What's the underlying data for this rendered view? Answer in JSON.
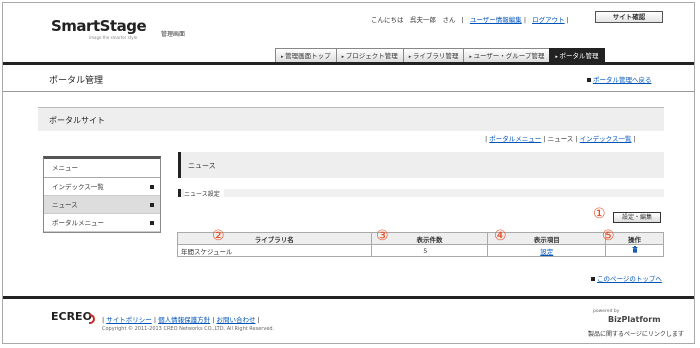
{
  "header": {
    "logo": "SmartStage",
    "logo_sub": "image the smarter style",
    "admin_title": "管理画面",
    "greeting": "こんにちは　呉夫一郎　さん",
    "user_info_edit": "ユーザー情報編集",
    "logout": "ログアウト",
    "site_confirm": "サイト確認"
  },
  "nav": {
    "items": [
      {
        "label": "管理画面トップ",
        "active": false
      },
      {
        "label": "プロジェクト管理",
        "active": false
      },
      {
        "label": "ライブラリ管理",
        "active": false
      },
      {
        "label": "ユーザー・グループ管理",
        "active": false
      },
      {
        "label": "ポータル管理",
        "active": true
      }
    ]
  },
  "page": {
    "title": "ポータル管理",
    "back_link": "ポータル管理へ戻る",
    "section_title": "ポータルサイト",
    "sub_links": [
      "ポータルメニュー",
      "ニュース",
      "インデックス一覧"
    ]
  },
  "menu": {
    "heading": "メニュー",
    "items": [
      {
        "label": "インデックス一覧",
        "active": false
      },
      {
        "label": "ニュース",
        "active": true
      },
      {
        "label": "ポータルメニュー",
        "active": false
      }
    ]
  },
  "main": {
    "news_title": "ニュース",
    "setting_label": "ニュース設定",
    "edit_button": "設定・編集",
    "table": {
      "headers": [
        "ライブラリ名",
        "表示件数",
        "表示項目",
        "操作"
      ],
      "rows": [
        {
          "name": "年間スケジュール",
          "count": "5",
          "item": "設定",
          "action": "delete-icon"
        }
      ]
    },
    "annotations": [
      "①",
      "②",
      "③",
      "④",
      "⑤"
    ],
    "annotation_color": "#e8471e",
    "page_top_link": "このページのトップへ"
  },
  "footer": {
    "brand": "ECREO",
    "links": [
      "サイトポリシー",
      "個人情報保護方針",
      "お問い合わせ"
    ],
    "copyright": "Copyright © 2011-2013 CREO Networks CO.,LTD. All Right Reserved.",
    "powered_by": "powered by",
    "platform": "BizPlatform",
    "note": "製品に関するページにリンクします"
  }
}
